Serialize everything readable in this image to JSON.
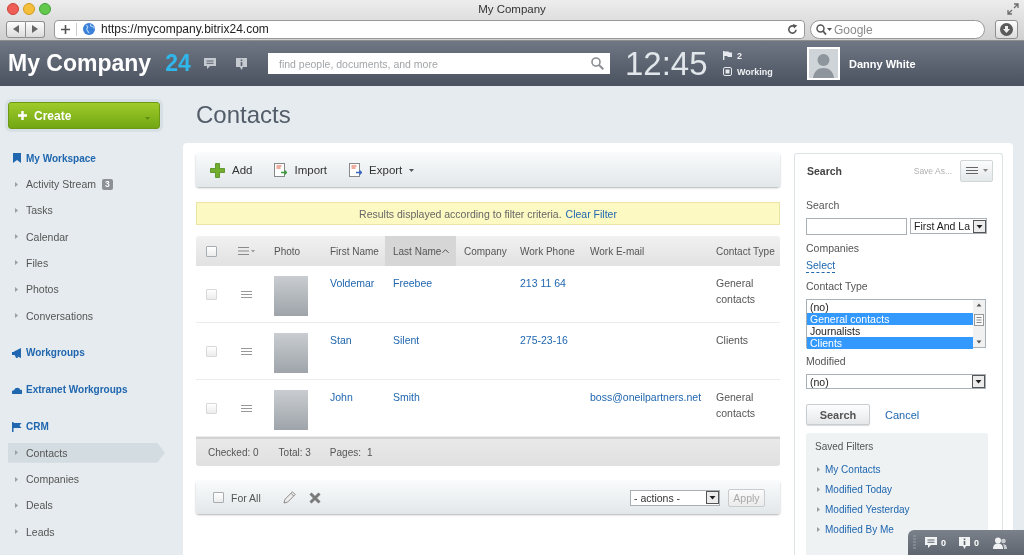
{
  "browser": {
    "title": "My Company",
    "url": "https://mycompany.bitrix24.com",
    "search_placeholder": "Google"
  },
  "header": {
    "logo": "My Company",
    "logo_number": "24",
    "search_placeholder": "find people, documents, and more",
    "clock": "12:45",
    "flag_count": "2",
    "status": "Working",
    "user_name": "Danny White"
  },
  "sidebar": {
    "create_button": "Create",
    "sections": [
      {
        "title": "My Workspace",
        "kind": "bookmark",
        "items": [
          {
            "label": "Activity Stream",
            "badge": "3",
            "selected": false
          },
          {
            "label": "Tasks",
            "selected": false
          },
          {
            "label": "Calendar",
            "selected": false
          },
          {
            "label": "Files",
            "selected": false
          },
          {
            "label": "Photos",
            "selected": false
          },
          {
            "label": "Conversations",
            "selected": false
          }
        ]
      },
      {
        "title": "Workgroups",
        "kind": "megaphone"
      },
      {
        "title": "Extranet Workgroups",
        "kind": "cloud"
      },
      {
        "title": "CRM",
        "kind": "flag",
        "items": [
          {
            "label": "Contacts",
            "selected": true
          },
          {
            "label": "Companies",
            "selected": false
          },
          {
            "label": "Deals",
            "selected": false
          },
          {
            "label": "Leads",
            "selected": false
          }
        ]
      }
    ]
  },
  "page_title": "Contacts",
  "toolbar": [
    {
      "kind": "add",
      "label": "Add",
      "dropdown": false
    },
    {
      "kind": "import",
      "label": "Import",
      "dropdown": false
    },
    {
      "kind": "export",
      "label": "Export",
      "dropdown": true
    }
  ],
  "filter_notice": {
    "text": "Results displayed according to filter criteria.",
    "link": "Clear Filter"
  },
  "table": {
    "select_all_checked": false,
    "columns": [
      {
        "label": "Photo",
        "sorted": false
      },
      {
        "label": "First Name",
        "sorted": false
      },
      {
        "label": "Last Name",
        "sorted": true
      },
      {
        "label": "Company",
        "sorted": false
      },
      {
        "label": "Work Phone",
        "sorted": false
      },
      {
        "label": "Work E-mail",
        "sorted": false
      },
      {
        "label": "Contact Type",
        "sorted": false
      }
    ],
    "rows": [
      {
        "checked": false,
        "first_name": "Voldemar",
        "last_name": "Freebee",
        "work_phone": "213 11 64",
        "contact_type": "General contacts"
      },
      {
        "checked": false,
        "first_name": "Stan",
        "last_name": "Silent",
        "work_phone": "275-23-16",
        "contact_type": "Clients"
      },
      {
        "checked": false,
        "first_name": "John",
        "last_name": "Smith",
        "work_email": "boss@oneilpartners.net",
        "contact_type": "General contacts"
      }
    ],
    "footer": {
      "checked": "Checked: 0",
      "total": "Total: 3",
      "pages_label": "Pages:",
      "pages": "1"
    }
  },
  "actions_bar": {
    "for_all": "For All",
    "for_all_checked": false,
    "actions_select": "- actions -",
    "apply": "Apply",
    "apply_disabled": true
  },
  "filter_panel": {
    "title": "Search",
    "save_as": "Save As...",
    "fields": [
      {
        "kind": "text_select",
        "label": "Search",
        "select_value": "First And La"
      },
      {
        "kind": "link",
        "label": "Companies",
        "link": "Select"
      },
      {
        "kind": "listbox",
        "label": "Contact Type",
        "options": [
          {
            "label": "(no)",
            "selected": false
          },
          {
            "label": "General contacts",
            "selected": true
          },
          {
            "label": "Journalists",
            "selected": false
          },
          {
            "label": "Clients",
            "selected": true
          }
        ]
      },
      {
        "kind": "select",
        "label": "Modified",
        "value": "(no)"
      }
    ],
    "search_button": "Search",
    "cancel_link": "Cancel",
    "saved_filters": {
      "title": "Saved Filters",
      "items": [
        "My Contacts",
        "Modified Today",
        "Modified Yesterday",
        "Modified By Me"
      ]
    }
  },
  "notification_bar": {
    "messages": "0",
    "notifications": "0"
  }
}
